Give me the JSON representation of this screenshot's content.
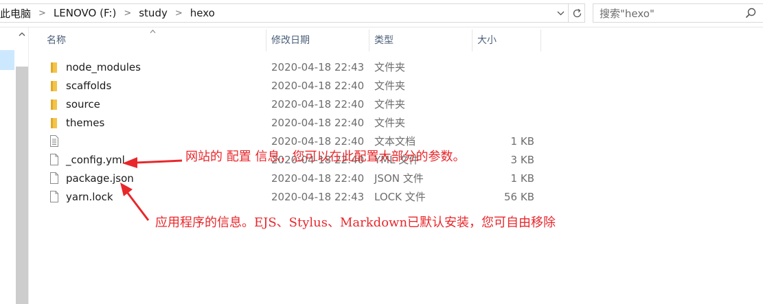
{
  "address_bar": {
    "breadcrumbs": [
      "此电脑",
      "LENOVO (F:)",
      "study",
      "hexo"
    ],
    "separator": ">",
    "dropdown_icon": "chevron-down-icon",
    "refresh_icon": "refresh-icon"
  },
  "search": {
    "placeholder": "搜索\"hexo\""
  },
  "columns": {
    "name": "名称",
    "date": "修改日期",
    "type": "类型",
    "size": "大小"
  },
  "files": [
    {
      "name": "node_modules",
      "date": "2020-04-18 22:43",
      "type": "文件夹",
      "size": "",
      "icon": "folder-icon"
    },
    {
      "name": "scaffolds",
      "date": "2020-04-18 22:40",
      "type": "文件夹",
      "size": "",
      "icon": "folder-icon"
    },
    {
      "name": "source",
      "date": "2020-04-18 22:40",
      "type": "文件夹",
      "size": "",
      "icon": "folder-icon"
    },
    {
      "name": "themes",
      "date": "2020-04-18 22:40",
      "type": "文件夹",
      "size": "",
      "icon": "folder-icon"
    },
    {
      "name": "",
      "date": "2020-04-18 22:40",
      "type": "文本文档",
      "size": "1 KB",
      "icon": "text-document-icon"
    },
    {
      "name": "_config.yml",
      "date": "2020-04-18 22:40",
      "type": "YML 文件",
      "size": "3 KB",
      "icon": "file-icon"
    },
    {
      "name": "package.json",
      "date": "2020-04-18 22:40",
      "type": "JSON 文件",
      "size": "1 KB",
      "icon": "file-icon"
    },
    {
      "name": "yarn.lock",
      "date": "2020-04-18 22:43",
      "type": "LOCK 文件",
      "size": "56 KB",
      "icon": "file-icon"
    }
  ],
  "annotations": {
    "config_note": "网站的 配置 信息，您可以在此配置大部分的参数。",
    "package_note": "应用程序的信息。EJS、Stylus、Markdown已默认安装，您可自由移除"
  },
  "colors": {
    "annotation": "#e8272b",
    "selection": "#cce8ff",
    "folder": "#f3c44a"
  }
}
